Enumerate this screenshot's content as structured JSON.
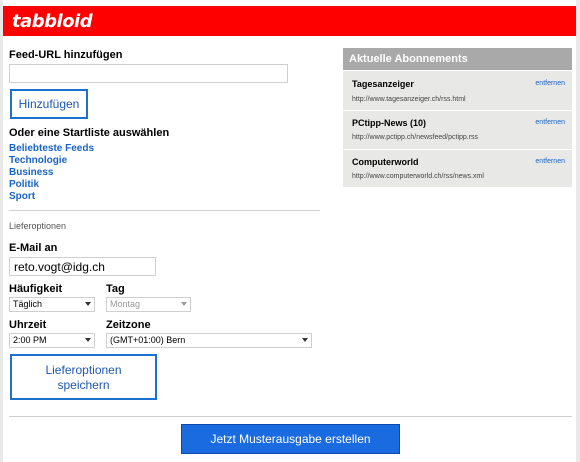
{
  "brand": {
    "logo": "tabbloid"
  },
  "feed": {
    "heading": "Feed-URL hinzufügen",
    "input_value": "",
    "add_button": "Hinzufügen"
  },
  "startlist": {
    "heading": "Oder eine Startliste auswählen",
    "items": [
      "Beliebteste Feeds",
      "Technologie",
      "Business",
      "Politik",
      "Sport"
    ]
  },
  "delivery": {
    "section_label": "Lieferoptionen",
    "email_label": "E-Mail an",
    "email_value": "reto.vogt@idg.ch",
    "frequency_label": "Häufigkeit",
    "frequency_value": "Täglich",
    "day_label": "Tag",
    "day_value": "Montag",
    "time_label": "Uhrzeit",
    "time_value": "2:00 PM",
    "timezone_label": "Zeitzone",
    "timezone_value": "(GMT+01:00) Bern",
    "save_button_line1": "Lieferoptionen",
    "save_button_line2": "speichern"
  },
  "subscriptions": {
    "heading": "Aktuelle Abonnements",
    "remove_label": "entfernen",
    "items": [
      {
        "title": "Tagesanzeiger",
        "url": "http://www.tagesanzeiger.ch/rss.html"
      },
      {
        "title": "PCtipp-News (10)",
        "url": "http://www.pctipp.ch/newsfeed/pctipp.rss"
      },
      {
        "title": "Computerworld",
        "url": "http://www.computerworld.ch/rss/news.xml"
      }
    ]
  },
  "footer": {
    "sample_button": "Jetzt Musterausgabe erstellen"
  },
  "colors": {
    "brand_red": "#ff0000",
    "link_blue": "#1a64c7",
    "primary_blue": "#1a6ae0",
    "panel_gray": "#a9a9a9"
  }
}
